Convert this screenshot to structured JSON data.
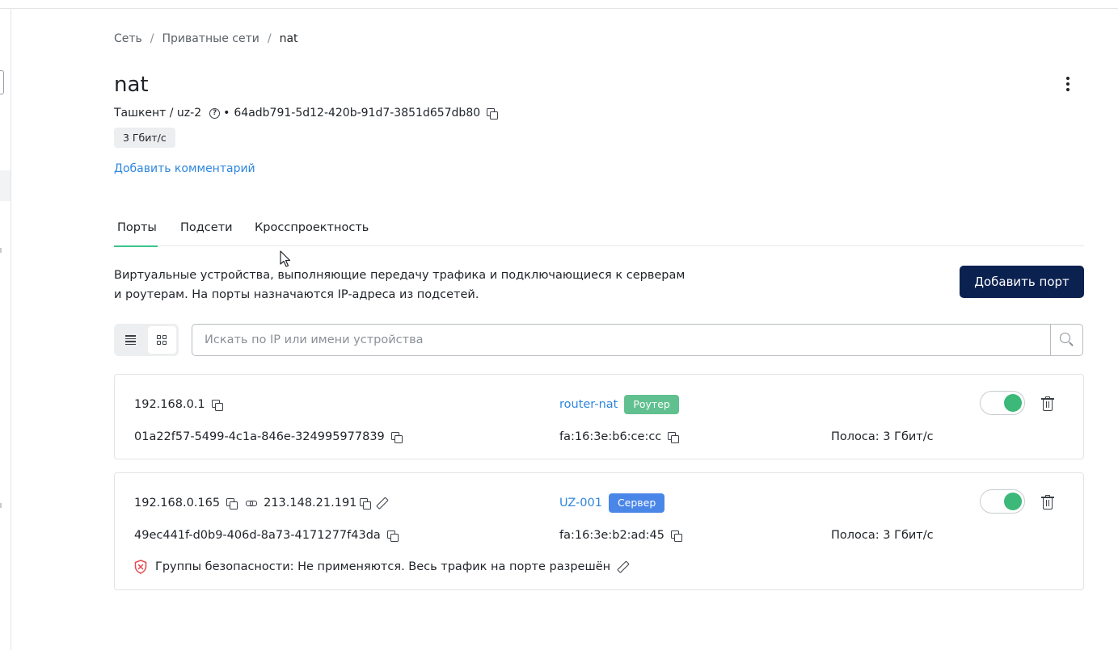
{
  "breadcrumb": {
    "items": [
      "Сеть",
      "Приватные сети"
    ],
    "current": "nat",
    "separator": "/"
  },
  "header": {
    "title": "nat",
    "location": "Ташкент / uz-2",
    "bullet": "•",
    "network_id": "64adb791-5d12-420b-91d7-3851d657db80",
    "speed_tag": "3 Гбит/с",
    "add_comment": "Добавить комментарий"
  },
  "tabs": [
    {
      "label": "Порты",
      "active": true
    },
    {
      "label": "Подсети",
      "active": false
    },
    {
      "label": "Кросспроектность",
      "active": false
    }
  ],
  "description": "Виртуальные устройства, выполняющие передачу трафика и подключающиеся к серверам и роутерам. На порты назначаются IP-адреса из подсетей.",
  "toolbar": {
    "add_port_label": "Добавить порт",
    "view_mode": "list"
  },
  "search": {
    "placeholder": "Искать по IP или имени устройства",
    "value": ""
  },
  "ports": [
    {
      "ip": "192.168.0.1",
      "port_id": "01a22f57-5499-4c1a-846e-324995977839",
      "device_name": "router-nat",
      "device_type": "Роутер",
      "mac": "fa:16:3e:b6:ce:cc",
      "bandwidth": "Полоса: 3 Гбит/с",
      "enabled": true
    },
    {
      "ip": "192.168.0.165",
      "floating_ip": "213.148.21.191",
      "port_id": "49ec441f-d0b9-406d-8a73-4171277f43da",
      "device_name": "UZ-001",
      "device_type": "Сервер",
      "mac": "fa:16:3e:b2:ad:45",
      "bandwidth": "Полоса: 3 Гбит/с",
      "security": "Группы безопасности: Не применяются. Весь трафик на порте разрешён",
      "enabled": true
    }
  ],
  "colors": {
    "accent_tab": "#3cc48a",
    "primary_button": "#0b2150",
    "link": "#2e86de",
    "router_badge": "#61c08f",
    "server_badge": "#4a86e8",
    "toggle_on": "#3cb878",
    "security_warning": "#e5484d"
  }
}
